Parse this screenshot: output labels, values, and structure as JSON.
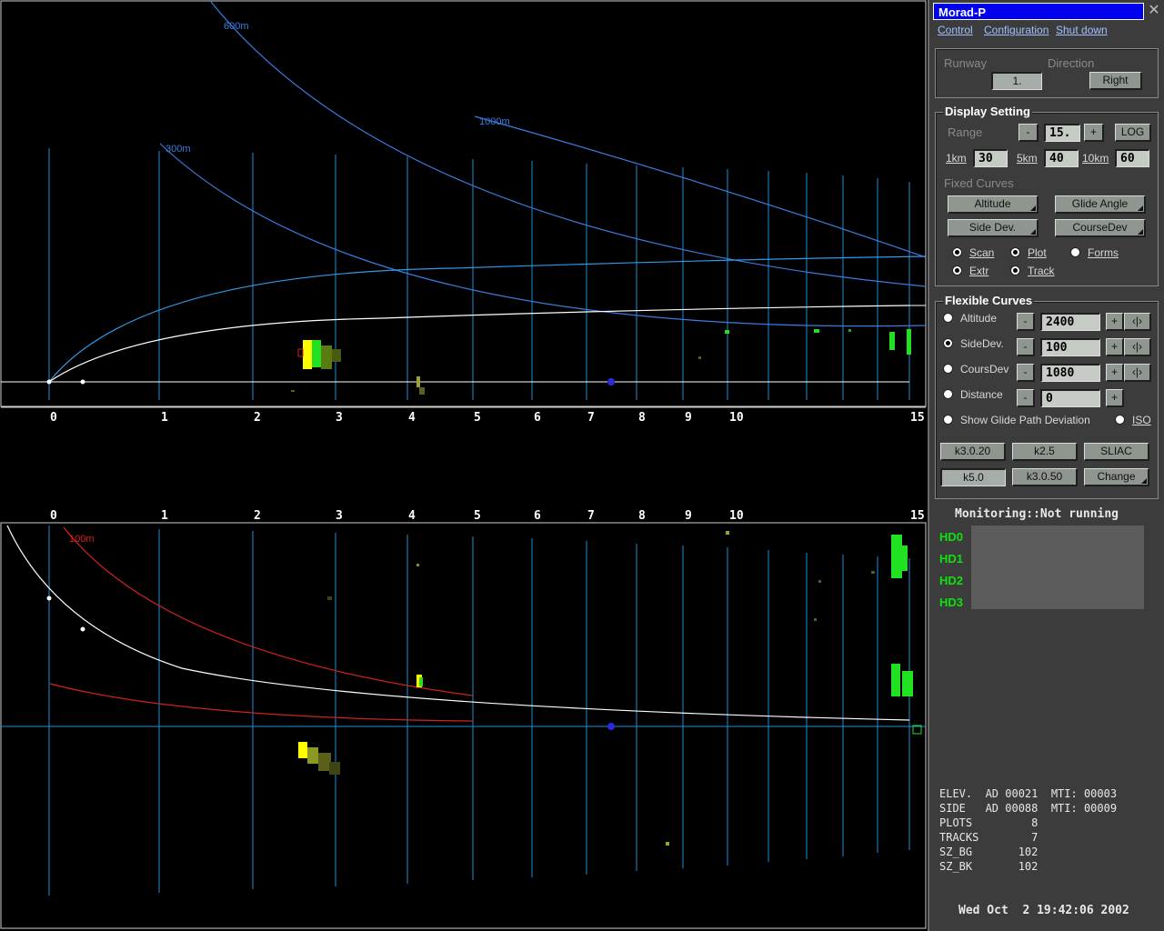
{
  "window": {
    "title": "Morad-P",
    "close": "✕"
  },
  "menu": {
    "control": "Control",
    "configuration": "Configuration",
    "shutdown": "Shut down"
  },
  "runway": {
    "label": "Runway",
    "value": "1."
  },
  "direction": {
    "label": "Direction",
    "value": "Right"
  },
  "display": {
    "title": "Display Setting",
    "range_label": "Range",
    "minus": "-",
    "plus": "+",
    "range_value": "15.",
    "log": "LOG",
    "k1_label": "1km",
    "k1_value": "30",
    "k5_label": "5km",
    "k5_value": "40",
    "k10_label": "10km",
    "k10_value": "60",
    "fixed_label": "Fixed Curves",
    "altitude": "Altitude",
    "glide_angle": "Glide Angle",
    "side_dev": "Side Dev.",
    "course_dev": "CourseDev",
    "scan": "Scan",
    "plot": "Plot",
    "forms": "Forms",
    "extr": "Extr",
    "track": "Track"
  },
  "flex": {
    "title": "Flexible Curves",
    "minus": "-",
    "plus": "+",
    "swap": "‹|›",
    "altitude_label": "Altitude",
    "altitude_value": "2400",
    "sidedev_label": "SideDev.",
    "sidedev_value": "100",
    "coursdev_label": "CoursDev",
    "coursdev_value": "1080",
    "distance_label": "Distance",
    "distance_value": "0",
    "show_glide": "Show Glide Path Deviation",
    "iso": "ISO"
  },
  "presets": {
    "k3020": "k3.0.20",
    "k25": "k2.5",
    "sliac": "SLIAC",
    "k50": "k5.0",
    "k3050": "k3.0.50",
    "change": "Change"
  },
  "monitoring": "Monitoring::Not running",
  "hd": [
    "HD0",
    "HD1",
    "HD2",
    "HD3"
  ],
  "stats": [
    "ELEV.  AD 00021  MTI: 00003",
    "SIDE   AD 00088  MTI: 00009",
    "PLOTS         8",
    "TRACKS        7",
    "SZ_BG       102",
    "SZ_BK       102"
  ],
  "datetime": "Wed Oct  2 19:42:06 2002",
  "radar": {
    "ticks": [
      "0",
      "1",
      "2",
      "3",
      "4",
      "5",
      "6",
      "7",
      "8",
      "9",
      "10",
      "15"
    ],
    "top_curve_labels": {
      "c600": "600m",
      "c300": "300m",
      "c1000": "1000m"
    },
    "bottom_curve_label": "100m",
    "colors": {
      "grid": "#1e8fd6",
      "curve": "#3a7de0",
      "glide": "#ffffff",
      "dev": "#d42020",
      "target_yellow": "#ffff00",
      "target_green": "#22e022",
      "marker": "#2a2ad8"
    }
  }
}
